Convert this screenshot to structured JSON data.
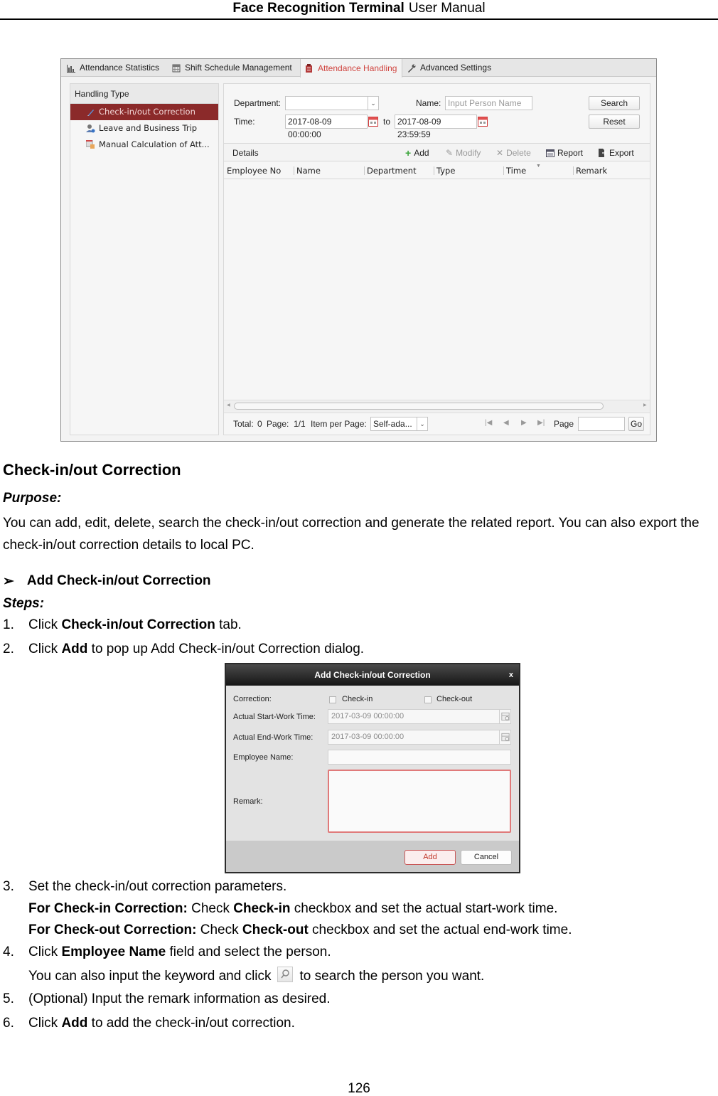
{
  "header": {
    "title": "Face Recognition Terminal",
    "subtitle": "User Manual"
  },
  "app": {
    "tabs": [
      {
        "label": "Attendance Statistics",
        "icon": "bar-chart-icon",
        "active": false
      },
      {
        "label": "Shift Schedule Management",
        "icon": "calendar-icon",
        "active": false
      },
      {
        "label": "Attendance Handling",
        "icon": "clipboard-icon",
        "active": true
      },
      {
        "label": "Advanced Settings",
        "icon": "wrench-icon",
        "active": false
      }
    ],
    "sidebar": {
      "title": "Handling Type",
      "items": [
        {
          "label": "Check-in/out Correction",
          "icon": "pencil-icon",
          "selected": true
        },
        {
          "label": "Leave and Business Trip",
          "icon": "person-clock-icon",
          "selected": false
        },
        {
          "label": "Manual Calculation of Att...",
          "icon": "calculator-hand-icon",
          "selected": false
        }
      ]
    },
    "filter": {
      "department_label": "Department:",
      "department_value": "",
      "name_label": "Name:",
      "name_placeholder": "Input Person Name",
      "time_label": "Time:",
      "time_from": "2017-08-09 00:00:00",
      "to_label": "to",
      "time_to": "2017-08-09 23:59:59",
      "search_label": "Search",
      "reset_label": "Reset"
    },
    "toolbar": {
      "title": "Details",
      "add": "Add",
      "modify": "Modify",
      "delete": "Delete",
      "report": "Report",
      "export": "Export"
    },
    "table": {
      "columns": [
        "Employee No",
        "Name",
        "Department",
        "Type",
        "Time",
        "Remark"
      ],
      "rows": []
    },
    "pager": {
      "total_label": "Total:",
      "total": "0",
      "page_label": "Page:",
      "page": "1/1",
      "items_label": "Item per Page:",
      "items_value": "Self-ada...",
      "goto_label": "Page",
      "goto_value": "",
      "go_label": "Go"
    }
  },
  "doc": {
    "heading": "Check-in/out Correction",
    "purpose_label": "Purpose:",
    "purpose_text": "You can add, edit, delete, search the check-in/out correction and generate the related report. You can also export the check-in/out correction details to local PC.",
    "subheading": "Add Check-in/out Correction",
    "steps_label": "Steps:",
    "step1": {
      "num": "1.",
      "pre": "Click ",
      "bold": "Check-in/out Correction",
      "post": " tab."
    },
    "step2": {
      "num": "2.",
      "pre": "Click ",
      "bold": "Add",
      "post": " to pop up Add Check-in/out Correction dialog."
    },
    "step3": {
      "num": "3.",
      "text": "Set the check-in/out correction parameters."
    },
    "step3a": {
      "bold1": "For Check-in Correction:",
      "mid": " Check ",
      "bold2": "Check-in",
      "post": " checkbox and set the actual start-work time."
    },
    "step3b": {
      "bold1": "For Check-out Correction:",
      "mid": " Check ",
      "bold2": "Check-out",
      "post": " checkbox and set the actual end-work time."
    },
    "step4": {
      "num": "4.",
      "pre": "Click ",
      "bold": "Employee Name",
      "post": " field and select the person."
    },
    "step4a": {
      "pre": "You can also input the keyword and click",
      "post": "to search the person you want."
    },
    "step5": {
      "num": "5.",
      "text": "(Optional) Input the remark information as desired."
    },
    "step6": {
      "num": "6.",
      "pre": "Click ",
      "bold": "Add",
      "post": " to add the check-in/out correction."
    }
  },
  "dialog": {
    "title": "Add Check-in/out Correction",
    "close": "x",
    "correction_label": "Correction:",
    "checkin_label": "Check-in",
    "checkin_checked": false,
    "checkout_label": "Check-out",
    "checkout_checked": false,
    "start_label": "Actual Start-Work Time:",
    "start_value": "2017-03-09 00:00:00",
    "end_label": "Actual End-Work Time:",
    "end_value": "2017-03-09 00:00:00",
    "employee_label": "Employee Name:",
    "employee_value": "",
    "remark_label": "Remark:",
    "remark_value": "",
    "add_label": "Add",
    "cancel_label": "Cancel"
  },
  "page_number": "126"
}
